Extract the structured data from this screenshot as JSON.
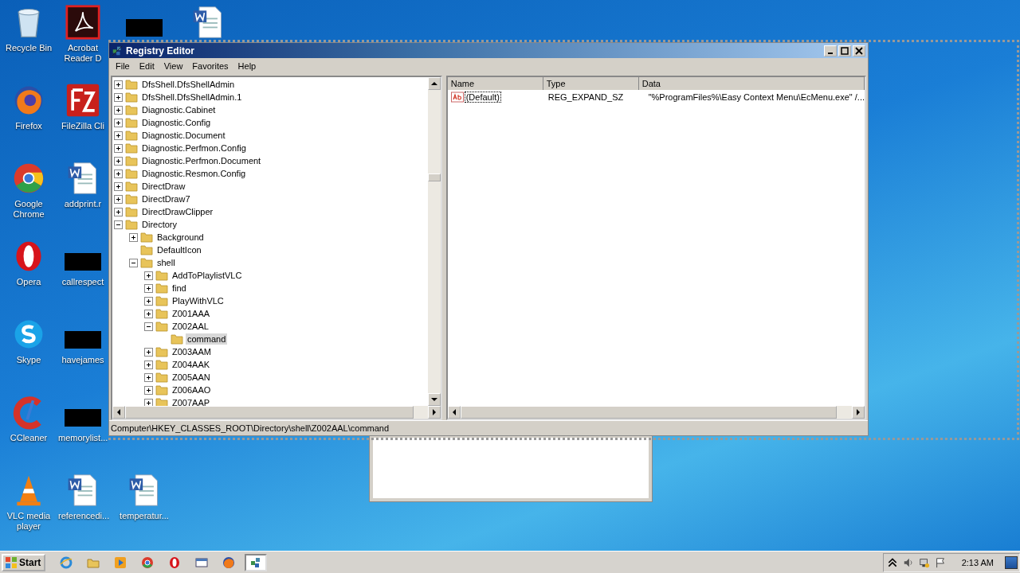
{
  "desktop": {
    "columns": [
      [
        {
          "kind": "recycle-bin",
          "label": "Recycle Bin"
        },
        {
          "kind": "firefox",
          "label": "Firefox"
        },
        {
          "kind": "chrome",
          "label": "Google Chrome"
        },
        {
          "kind": "opera",
          "label": "Opera"
        },
        {
          "kind": "skype",
          "label": "Skype"
        },
        {
          "kind": "ccleaner",
          "label": "CCleaner"
        },
        {
          "kind": "vlc",
          "label": "VLC media player"
        }
      ],
      [
        {
          "kind": "pdf",
          "label": "Acrobat Reader D"
        },
        {
          "kind": "filezilla",
          "label": "FileZilla Cli"
        },
        {
          "kind": "word",
          "label": "addprint.r"
        },
        {
          "kind": "redacted",
          "label": "callrespect"
        },
        {
          "kind": "redacted",
          "label": "havejames"
        },
        {
          "kind": "redacted",
          "label": "memorylist..."
        },
        {
          "kind": "word",
          "label": "referencedi..."
        }
      ],
      [
        {
          "kind": "redacted"
        },
        {
          "kind": "word",
          "label": "temperatur..."
        }
      ],
      [
        {
          "kind": "word"
        }
      ]
    ]
  },
  "window": {
    "title": "Registry Editor",
    "menu": [
      "File",
      "Edit",
      "View",
      "Favorites",
      "Help"
    ],
    "tree": [
      {
        "label": "DfsShell.DfsShellAdmin",
        "expanded": false,
        "selected": false
      },
      {
        "label": "DfsShell.DfsShellAdmin.1",
        "expanded": false,
        "selected": false
      },
      {
        "label": "Diagnostic.Cabinet",
        "expanded": false,
        "selected": false
      },
      {
        "label": "Diagnostic.Config",
        "expanded": false,
        "selected": false
      },
      {
        "label": "Diagnostic.Document",
        "expanded": false,
        "selected": false
      },
      {
        "label": "Diagnostic.Perfmon.Config",
        "expanded": false,
        "selected": false
      },
      {
        "label": "Diagnostic.Perfmon.Document",
        "expanded": false,
        "selected": false
      },
      {
        "label": "Diagnostic.Resmon.Config",
        "expanded": false,
        "selected": false
      },
      {
        "label": "DirectDraw",
        "expanded": false,
        "selected": false
      },
      {
        "label": "DirectDraw7",
        "expanded": false,
        "selected": false
      },
      {
        "label": "DirectDrawClipper",
        "expanded": false,
        "selected": false
      },
      {
        "label": "Directory",
        "expanded": true,
        "selected": false,
        "children": [
          {
            "label": "Background",
            "expanded": false,
            "selected": false
          },
          {
            "label": "DefaultIcon",
            "selected": false
          },
          {
            "label": "shell",
            "expanded": true,
            "selected": false,
            "children": [
              {
                "label": "AddToPlaylistVLC",
                "expanded": false,
                "selected": false
              },
              {
                "label": "find",
                "expanded": false,
                "selected": false
              },
              {
                "label": "PlayWithVLC",
                "expanded": false,
                "selected": false
              },
              {
                "label": "Z001AAA",
                "expanded": false,
                "selected": false
              },
              {
                "label": "Z002AAL",
                "expanded": true,
                "selected": false,
                "children": [
                  {
                    "label": "command",
                    "selected": true
                  }
                ]
              },
              {
                "label": "Z003AAM",
                "expanded": false,
                "selected": false
              },
              {
                "label": "Z004AAK",
                "expanded": false,
                "selected": false
              },
              {
                "label": "Z005AAN",
                "expanded": false,
                "selected": false
              },
              {
                "label": "Z006AAO",
                "expanded": false,
                "selected": false
              },
              {
                "label": "Z007AAP",
                "expanded": false,
                "selected": false
              }
            ]
          }
        ]
      }
    ],
    "values": {
      "columns": [
        "Name",
        "Type",
        "Data"
      ],
      "rows": [
        {
          "name": "(Default)",
          "type": "REG_EXPAND_SZ",
          "data": "\"%ProgramFiles%\\Easy Context Menu\\EcMenu.exe\" /..."
        }
      ]
    },
    "status_bar": "Computer\\HKEY_CLASSES_ROOT\\Directory\\shell\\Z002AAL\\command"
  },
  "taskbar": {
    "start": "Start",
    "items": [
      {
        "kind": "ie",
        "selected": false
      },
      {
        "kind": "explorer",
        "selected": false
      },
      {
        "kind": "media",
        "selected": false
      },
      {
        "kind": "chrome",
        "selected": false
      },
      {
        "kind": "opera",
        "selected": false
      },
      {
        "kind": "window",
        "selected": false
      },
      {
        "kind": "firefox",
        "selected": false
      },
      {
        "kind": "regedit",
        "selected": true
      }
    ],
    "clock": "2:13 AM"
  }
}
